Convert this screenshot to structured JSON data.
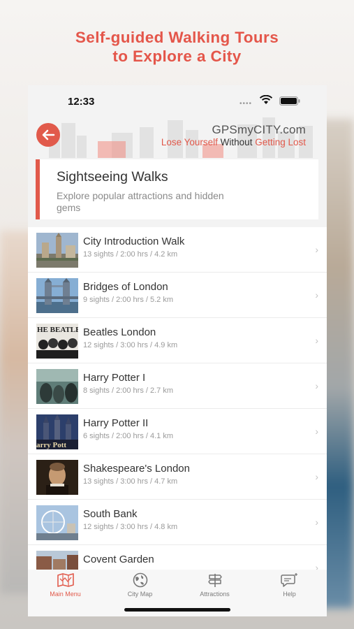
{
  "headline": {
    "line1": "Self-guided Walking Tours",
    "line2": "to Explore a City"
  },
  "status_bar": {
    "time": "12:33"
  },
  "header": {
    "brand": "GPSmyCITY.com",
    "tagline_part1": "Lose Yourself",
    "tagline_part2": " Without ",
    "tagline_part3": "Getting Lost",
    "back_icon": "arrow-left-icon"
  },
  "section": {
    "title": "Sightseeing Walks",
    "subtitle": "Explore popular attractions and hidden gems"
  },
  "tours": [
    {
      "title": "City Introduction Walk",
      "meta": "13 sights / 2:00 hrs / 4.2 km"
    },
    {
      "title": "Bridges of London",
      "meta": "9 sights / 2:00 hrs / 5.2 km"
    },
    {
      "title": "Beatles London",
      "meta": "12 sights / 3:00 hrs / 4.9 km",
      "thumb_text": "HE BEATLE"
    },
    {
      "title": "Harry Potter I",
      "meta": "8 sights / 2:00 hrs / 2.7 km"
    },
    {
      "title": "Harry Potter II",
      "meta": "6 sights / 2:00 hrs / 4.1 km",
      "thumb_text": "arry Pott"
    },
    {
      "title": "Shakespeare's London",
      "meta": "13 sights / 3:00 hrs / 4.7 km"
    },
    {
      "title": "South Bank",
      "meta": "12 sights / 3:00 hrs / 4.8 km"
    },
    {
      "title": "Covent Garden",
      "meta": ""
    }
  ],
  "tabs": [
    {
      "label": "Main Menu",
      "icon": "map-icon",
      "active": true
    },
    {
      "label": "City Map",
      "icon": "globe-icon",
      "active": false
    },
    {
      "label": "Attractions",
      "icon": "signpost-icon",
      "active": false
    },
    {
      "label": "Help",
      "icon": "chat-bubble-icon",
      "active": false
    }
  ],
  "colors": {
    "accent": "#e15a4b",
    "headline": "#e4564a"
  }
}
